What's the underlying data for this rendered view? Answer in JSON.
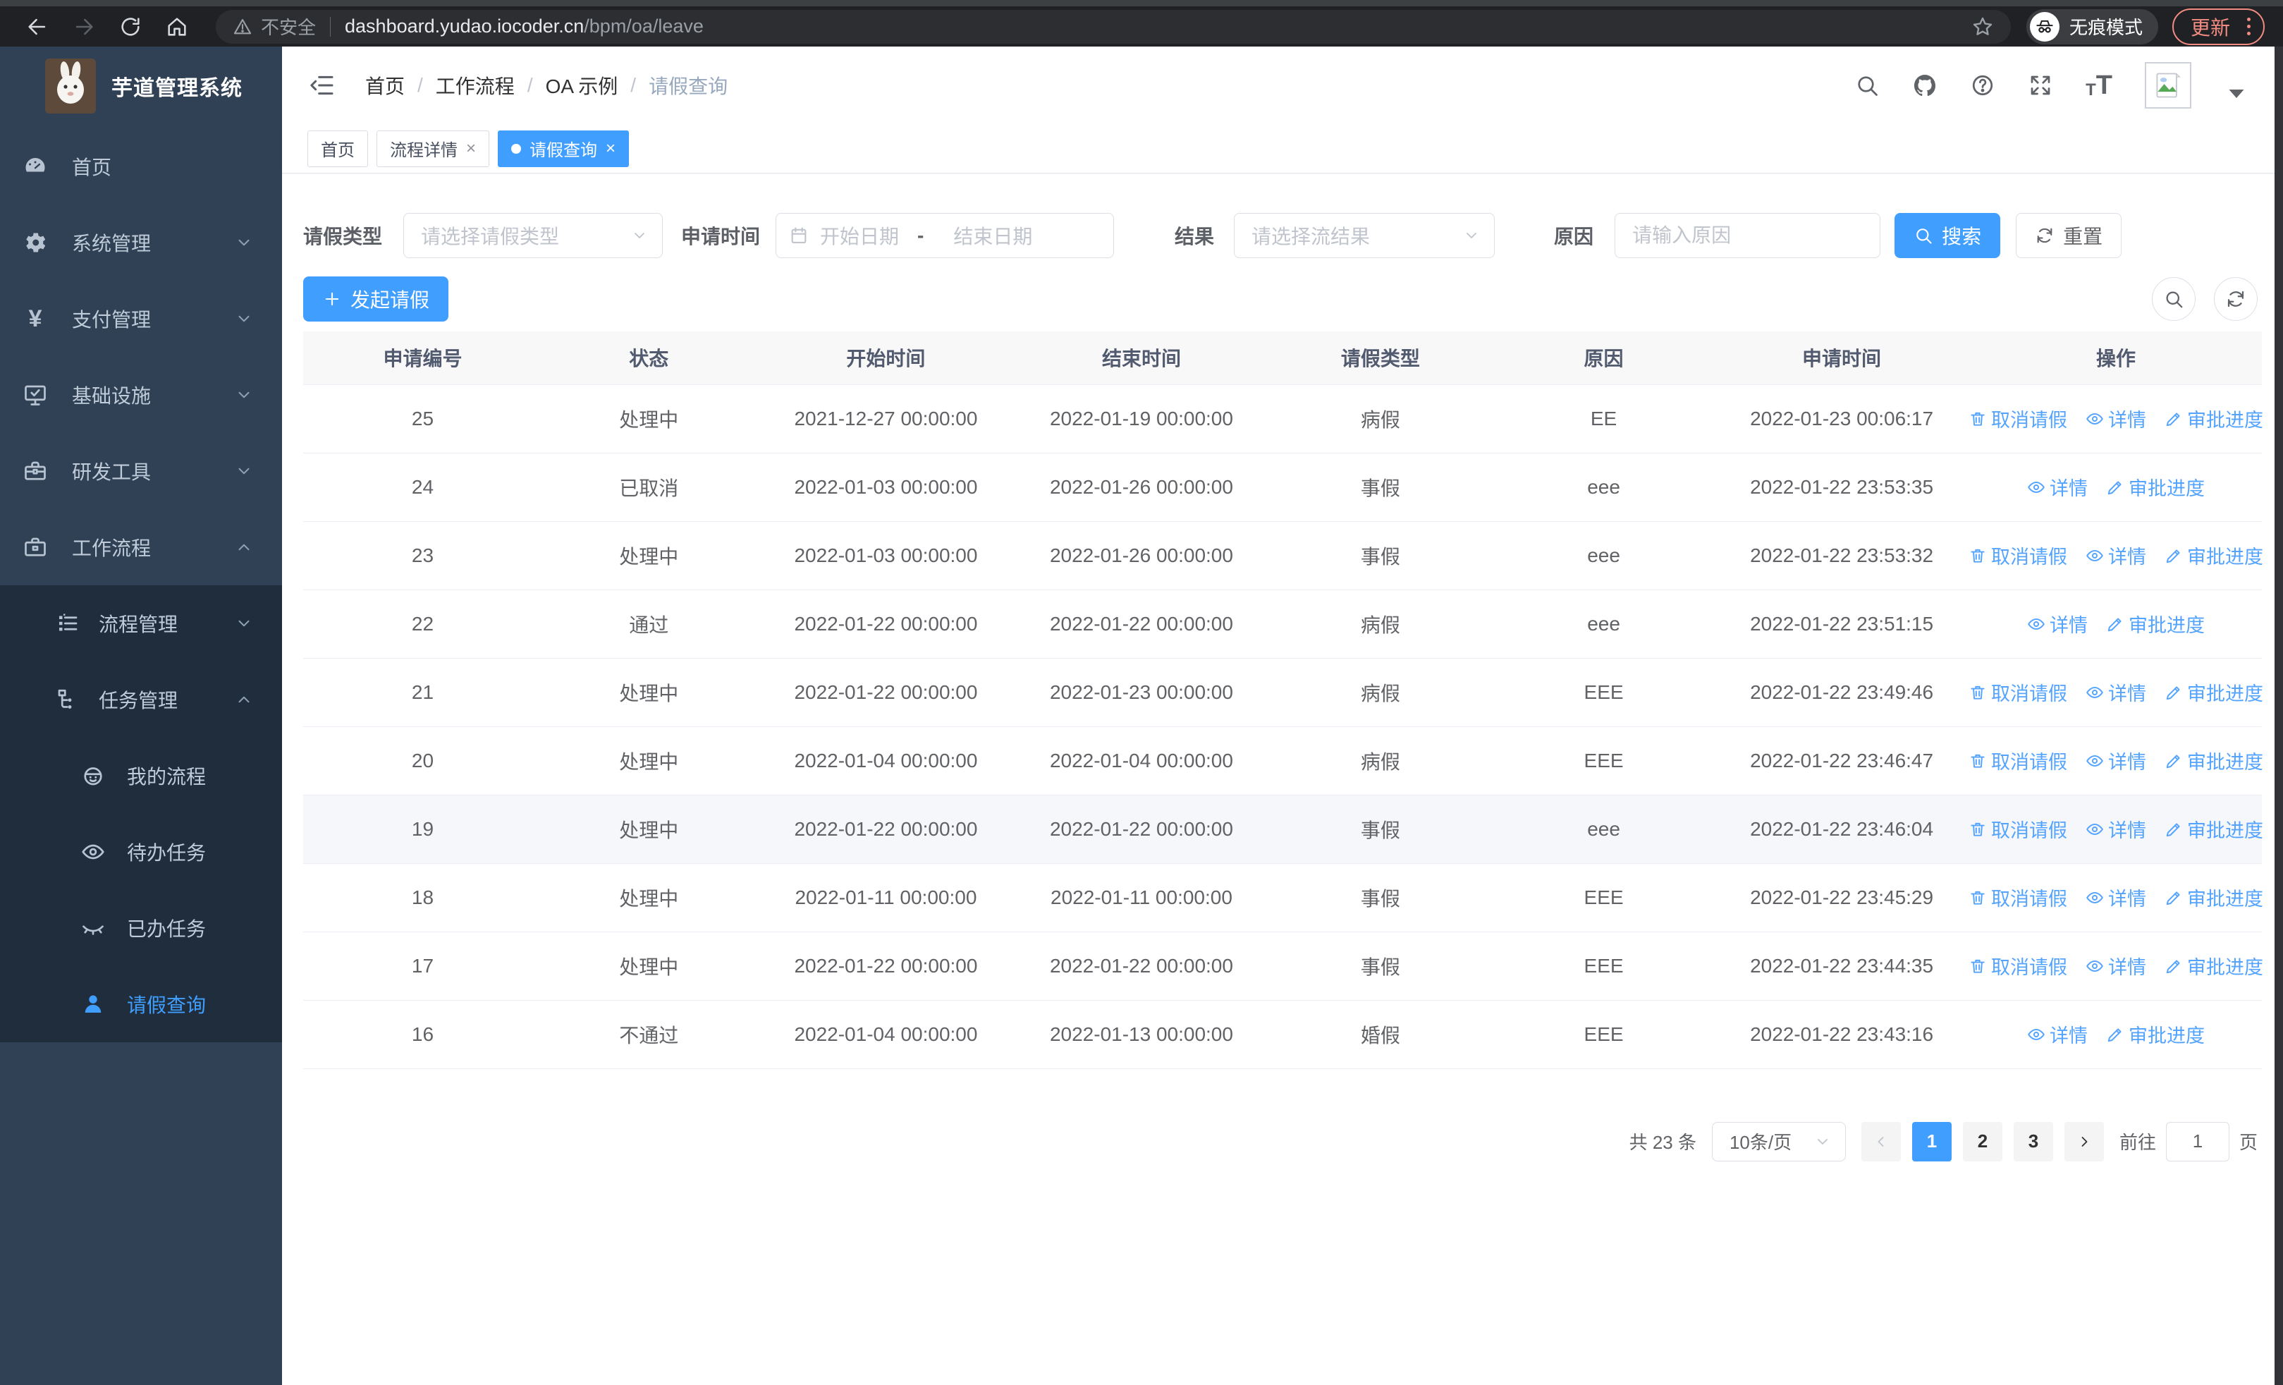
{
  "colors": {
    "primary": "#409eff",
    "sidebar_bg": "#304156",
    "submenu_bg": "#1f2d3d",
    "link_blue": "#54a4ff",
    "update_coral": "#f28b82"
  },
  "browser": {
    "security_label": "不安全",
    "url_host": "dashboard.yudao.iocoder.cn",
    "url_path": "/bpm/oa/leave",
    "incognito_label": "无痕模式",
    "update_label": "更新"
  },
  "app": {
    "title": "芋道管理系统"
  },
  "breadcrumb": [
    "首页",
    "工作流程",
    "OA 示例",
    "请假查询"
  ],
  "tabs": [
    {
      "key": "home",
      "label": "首页",
      "closable": false,
      "active": false
    },
    {
      "key": "process-detail",
      "label": "流程详情",
      "closable": true,
      "active": false
    },
    {
      "key": "leave-query",
      "label": "请假查询",
      "closable": true,
      "active": true
    }
  ],
  "sidebar": {
    "items": [
      {
        "key": "home",
        "label": "首页",
        "icon": "dashboard-icon",
        "level": 1
      },
      {
        "key": "system",
        "label": "系统管理",
        "icon": "gear-icon",
        "level": 1,
        "chevron": "down"
      },
      {
        "key": "payment",
        "label": "支付管理",
        "icon": "yen-icon",
        "level": 1,
        "chevron": "down"
      },
      {
        "key": "infra",
        "label": "基础设施",
        "icon": "monitor-icon",
        "level": 1,
        "chevron": "down"
      },
      {
        "key": "devtools",
        "label": "研发工具",
        "icon": "toolbox-icon",
        "level": 1,
        "chevron": "down"
      },
      {
        "key": "workflow",
        "label": "工作流程",
        "icon": "briefcase-icon",
        "level": 1,
        "chevron": "up"
      },
      {
        "key": "process-mgmt",
        "label": "流程管理",
        "icon": "flow-list-icon",
        "level": 2,
        "chevron": "down",
        "submenu": true
      },
      {
        "key": "task-mgmt",
        "label": "任务管理",
        "icon": "tree-icon",
        "level": 2,
        "chevron": "up",
        "submenu": true
      },
      {
        "key": "my-process",
        "label": "我的流程",
        "icon": "robot-icon",
        "level": 3,
        "submenu": true
      },
      {
        "key": "todo-tasks",
        "label": "待办任务",
        "icon": "eye-open-icon",
        "level": 3,
        "submenu": true
      },
      {
        "key": "done-tasks",
        "label": "已办任务",
        "icon": "eye-closed-icon",
        "level": 3,
        "submenu": true
      },
      {
        "key": "leave-query",
        "label": "请假查询",
        "icon": "user-icon",
        "level": 3,
        "submenu": true,
        "active": true
      }
    ]
  },
  "filters": {
    "leave_type": {
      "label": "请假类型",
      "placeholder": "请选择请假类型"
    },
    "apply_time": {
      "label": "申请时间",
      "start_placeholder": "开始日期",
      "separator": "-",
      "end_placeholder": "结束日期"
    },
    "result": {
      "label": "结果",
      "placeholder": "请选择流结果"
    },
    "reason": {
      "label": "原因",
      "placeholder": "请输入原因"
    },
    "search_button": "搜索",
    "reset_button": "重置"
  },
  "toolbar": {
    "create_button": "发起请假"
  },
  "table": {
    "columns": [
      "申请编号",
      "状态",
      "开始时间",
      "结束时间",
      "请假类型",
      "原因",
      "申请时间",
      "操作"
    ],
    "action_labels": {
      "cancel": "取消请假",
      "detail": "详情",
      "progress": "审批进度"
    },
    "rows": [
      {
        "id": "25",
        "status": "处理中",
        "start": "2021-12-27 00:00:00",
        "end": "2022-01-19 00:00:00",
        "type": "病假",
        "reason": "EE",
        "applied": "2022-01-23 00:06:17",
        "actions": [
          "cancel",
          "detail",
          "progress"
        ],
        "highlight": false
      },
      {
        "id": "24",
        "status": "已取消",
        "start": "2022-01-03 00:00:00",
        "end": "2022-01-26 00:00:00",
        "type": "事假",
        "reason": "eee",
        "applied": "2022-01-22 23:53:35",
        "actions": [
          "detail",
          "progress"
        ],
        "highlight": false
      },
      {
        "id": "23",
        "status": "处理中",
        "start": "2022-01-03 00:00:00",
        "end": "2022-01-26 00:00:00",
        "type": "事假",
        "reason": "eee",
        "applied": "2022-01-22 23:53:32",
        "actions": [
          "cancel",
          "detail",
          "progress"
        ],
        "highlight": false
      },
      {
        "id": "22",
        "status": "通过",
        "start": "2022-01-22 00:00:00",
        "end": "2022-01-22 00:00:00",
        "type": "病假",
        "reason": "eee",
        "applied": "2022-01-22 23:51:15",
        "actions": [
          "detail",
          "progress"
        ],
        "highlight": false
      },
      {
        "id": "21",
        "status": "处理中",
        "start": "2022-01-22 00:00:00",
        "end": "2022-01-23 00:00:00",
        "type": "病假",
        "reason": "EEE",
        "applied": "2022-01-22 23:49:46",
        "actions": [
          "cancel",
          "detail",
          "progress"
        ],
        "highlight": false
      },
      {
        "id": "20",
        "status": "处理中",
        "start": "2022-01-04 00:00:00",
        "end": "2022-01-04 00:00:00",
        "type": "病假",
        "reason": "EEE",
        "applied": "2022-01-22 23:46:47",
        "actions": [
          "cancel",
          "detail",
          "progress"
        ],
        "highlight": false
      },
      {
        "id": "19",
        "status": "处理中",
        "start": "2022-01-22 00:00:00",
        "end": "2022-01-22 00:00:00",
        "type": "事假",
        "reason": "eee",
        "applied": "2022-01-22 23:46:04",
        "actions": [
          "cancel",
          "detail",
          "progress"
        ],
        "highlight": true
      },
      {
        "id": "18",
        "status": "处理中",
        "start": "2022-01-11 00:00:00",
        "end": "2022-01-11 00:00:00",
        "type": "事假",
        "reason": "EEE",
        "applied": "2022-01-22 23:45:29",
        "actions": [
          "cancel",
          "detail",
          "progress"
        ],
        "highlight": false
      },
      {
        "id": "17",
        "status": "处理中",
        "start": "2022-01-22 00:00:00",
        "end": "2022-01-22 00:00:00",
        "type": "事假",
        "reason": "EEE",
        "applied": "2022-01-22 23:44:35",
        "actions": [
          "cancel",
          "detail",
          "progress"
        ],
        "highlight": false
      },
      {
        "id": "16",
        "status": "不通过",
        "start": "2022-01-04 00:00:00",
        "end": "2022-01-13 00:00:00",
        "type": "婚假",
        "reason": "EEE",
        "applied": "2022-01-22 23:43:16",
        "actions": [
          "detail",
          "progress"
        ],
        "highlight": false
      }
    ]
  },
  "pagination": {
    "total_text": "共 23 条",
    "page_size": "10条/页",
    "pages": [
      "1",
      "2",
      "3"
    ],
    "active_page": "1",
    "goto_label": "前往",
    "goto_value": "1",
    "page_suffix": "页"
  }
}
